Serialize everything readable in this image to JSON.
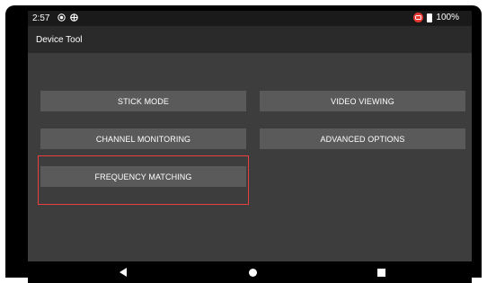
{
  "status_bar": {
    "time": "2:57",
    "rec_icon": "record-icon",
    "sync_icon": "sync-icon",
    "notification_icon": "notification-icon",
    "battery_icon": "battery-icon",
    "battery_text": "100%"
  },
  "app_bar": {
    "title": "Device Tool"
  },
  "menu": {
    "stick_mode": "STICK MODE",
    "video_viewing": "VIDEO VIEWING",
    "channel_monitoring": "CHANNEL MONITORING",
    "advanced_options": "ADVANCED OPTIONS",
    "frequency_matching": "FREQUENCY MATCHING"
  },
  "highlight": {
    "color": "#e8403c",
    "target": "frequency_matching"
  },
  "navigation": {
    "back_icon": "back-triangle-icon",
    "home_icon": "home-circle-icon",
    "recents_icon": "recents-square-icon"
  },
  "colors": {
    "background": "#3d3d3d",
    "button": "#5a5a5a",
    "app_bar": "#2a2a2a",
    "status_bar": "#1a1a1a"
  }
}
